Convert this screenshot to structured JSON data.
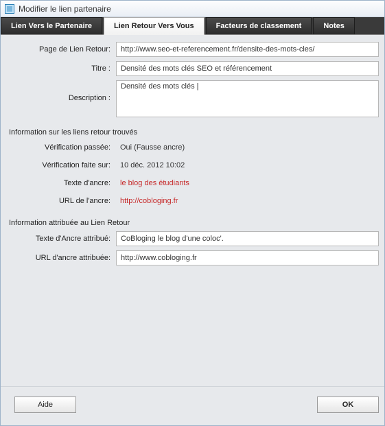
{
  "window": {
    "title": "Modifier le lien partenaire"
  },
  "tabs": {
    "partner": "Lien Vers le Partenaire",
    "back": "Lien Retour Vers Vous",
    "ranking": "Facteurs de classement",
    "notes": "Notes"
  },
  "form": {
    "backlink_page_label": "Page de Lien Retour:",
    "backlink_page_value": "http://www.seo-et-referencement.fr/densite-des-mots-cles/",
    "title_label": "Titre :",
    "title_value": "Densité des mots clés SEO et référencement",
    "description_label": "Description :",
    "description_value": "Densité des mots clés |"
  },
  "found_info": {
    "heading": "Information sur les liens retour trouvés",
    "verify_passed_label": "Vérification passée:",
    "verify_passed_value": "Oui (Fausse ancre)",
    "verify_on_label": "Vérification faite sur:",
    "verify_on_value": "10 déc. 2012 10:02",
    "anchor_text_label": "Texte d'ancre:",
    "anchor_text_value": "le blog des étudiants",
    "anchor_url_label": "URL de l'ancre:",
    "anchor_url_value": "http://cobloging.fr"
  },
  "assigned_info": {
    "heading": "Information attribuée au Lien Retour",
    "anchor_text_label": "Texte d'Ancre attribué:",
    "anchor_text_value": "CoBloging le blog d'une coloc'.",
    "anchor_url_label": "URL d'ancre attribuée:",
    "anchor_url_value": "http://www.cobloging.fr"
  },
  "buttons": {
    "help": "Aide",
    "ok": "OK"
  }
}
